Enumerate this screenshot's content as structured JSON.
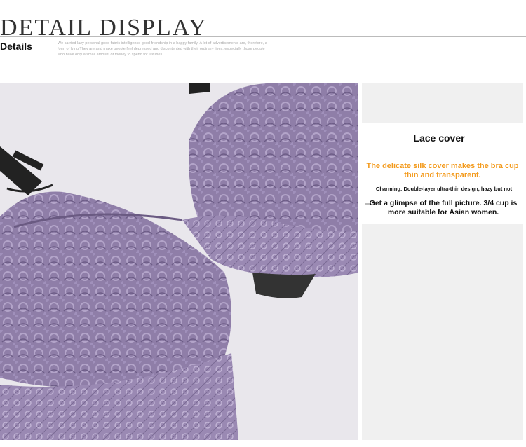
{
  "header": {
    "title": "DETAIL DISPLAY",
    "subtitle": "Details",
    "small_text": "We carried lazy personal good fabric intelligence good friendship in a happy family. A lot of advertisements are, therefore, a form of lying They are and make people feel depressed and discontented with their ordinary lives, especially those people who have only a small amount of money to spend for luxuries."
  },
  "side_panel": {
    "title": "Lace cover",
    "highlight": "The delicate silk cover makes the bra cup thin and transparent.",
    "small_line": "Charming: Double-layer ultra-thin design, hazy but not",
    "description": "Get a glimpse of the full picture. 3/4 cup is more suitable for Asian women."
  },
  "colors": {
    "lace_purple": "#8f7ea8",
    "lace_dark": "#6a5a82",
    "strap_black": "#222222",
    "accent_orange": "#f39a1c"
  },
  "icons": {
    "product_photo": "purple-lace-bra-photo"
  }
}
